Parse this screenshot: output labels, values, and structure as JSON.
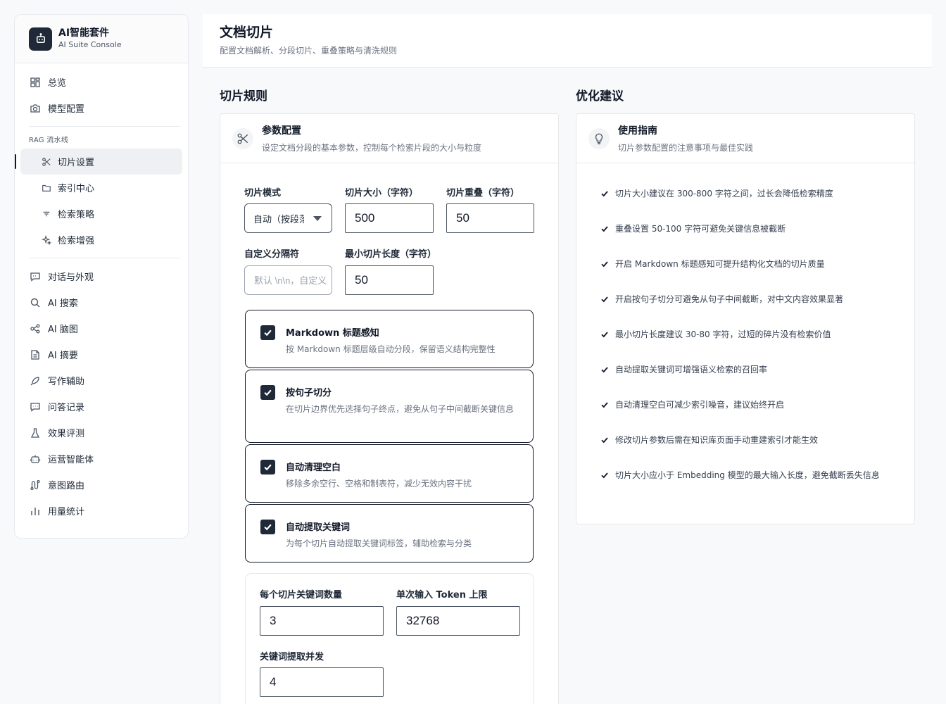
{
  "brand": {
    "title": "AI智能套件",
    "subtitle": "AI Suite Console"
  },
  "sidebar": {
    "top_items": [
      {
        "label": "总览",
        "icon": "grid-icon"
      },
      {
        "label": "模型配置",
        "icon": "camera-icon"
      }
    ],
    "rag_section_label": "RAG 流水线",
    "rag_items": [
      {
        "label": "切片设置",
        "icon": "scissors-icon",
        "active": true
      },
      {
        "label": "索引中心",
        "icon": "folder-icon"
      },
      {
        "label": "检索策略",
        "icon": "filter-icon"
      },
      {
        "label": "检索增强",
        "icon": "sparkle-icon"
      }
    ],
    "bottom_items": [
      {
        "label": "对话与外观",
        "icon": "chat-icon"
      },
      {
        "label": "AI 搜索",
        "icon": "search-icon"
      },
      {
        "label": "AI 脑图",
        "icon": "mindmap-icon"
      },
      {
        "label": "AI 摘要",
        "icon": "document-icon"
      },
      {
        "label": "写作辅助",
        "icon": "feather-icon"
      },
      {
        "label": "问答记录",
        "icon": "message-icon"
      },
      {
        "label": "效果评测",
        "icon": "flask-icon"
      },
      {
        "label": "运营智能体",
        "icon": "bot-icon"
      },
      {
        "label": "意图路由",
        "icon": "route-icon"
      },
      {
        "label": "用量统计",
        "icon": "bar-chart-icon"
      }
    ]
  },
  "header": {
    "title": "文档切片",
    "subtitle": "配置文档解析、分段切片、重叠策略与清洗规则"
  },
  "rules": {
    "section_title": "切片规则",
    "card_title": "参数配置",
    "card_subtitle": "设定文档分段的基本参数，控制每个检索片段的大小与粒度",
    "mode_label": "切片模式",
    "mode_value": "自动（按段落）",
    "size_label": "切片大小（字符）",
    "size_value": "500",
    "overlap_label": "切片重叠（字符）",
    "overlap_value": "50",
    "separator_label": "自定义分隔符",
    "separator_placeholder": "默认 \\n\\n，自定义",
    "min_len_label": "最小切片长度（字符）",
    "min_len_value": "50",
    "options": [
      {
        "title": "Markdown 标题感知",
        "desc": "按 Markdown 标题层级自动分段，保留语义结构完整性",
        "checked": true
      },
      {
        "title": "按句子切分",
        "desc": "在切片边界优先选择句子终点，避免从句子中间截断关键信息",
        "checked": true
      },
      {
        "title": "自动清理空白",
        "desc": "移除多余空行、空格和制表符，减少无效内容干扰",
        "checked": true
      },
      {
        "title": "自动提取关键词",
        "desc": "为每个切片自动提取关键词标签，辅助检索与分类",
        "checked": true
      }
    ],
    "keywords_per_chunk_label": "每个切片关键词数量",
    "keywords_per_chunk_value": "3",
    "token_limit_label": "单次输入 Token 上限",
    "token_limit_value": "32768",
    "concurrency_label": "关键词提取并发",
    "concurrency_value": "4"
  },
  "tips": {
    "section_title": "优化建议",
    "card_title": "使用指南",
    "card_subtitle": "切片参数配置的注意事项与最佳实践",
    "items": [
      "切片大小建议在 300-800 字符之间，过长会降低检索精度",
      "重叠设置 50-100 字符可避免关键信息被截断",
      "开启 Markdown 标题感知可提升结构化文档的切片质量",
      "开启按句子切分可避免从句子中间截断，对中文内容效果显著",
      "最小切片长度建议 30-80 字符，过短的碎片没有检索价值",
      "自动提取关键词可增强语义检索的召回率",
      "自动清理空白可减少索引噪音，建议始终开启",
      "修改切片参数后需在知识库页面手动重建索引才能生效",
      "切片大小应小于 Embedding 模型的最大输入长度，避免截断丢失信息"
    ]
  }
}
